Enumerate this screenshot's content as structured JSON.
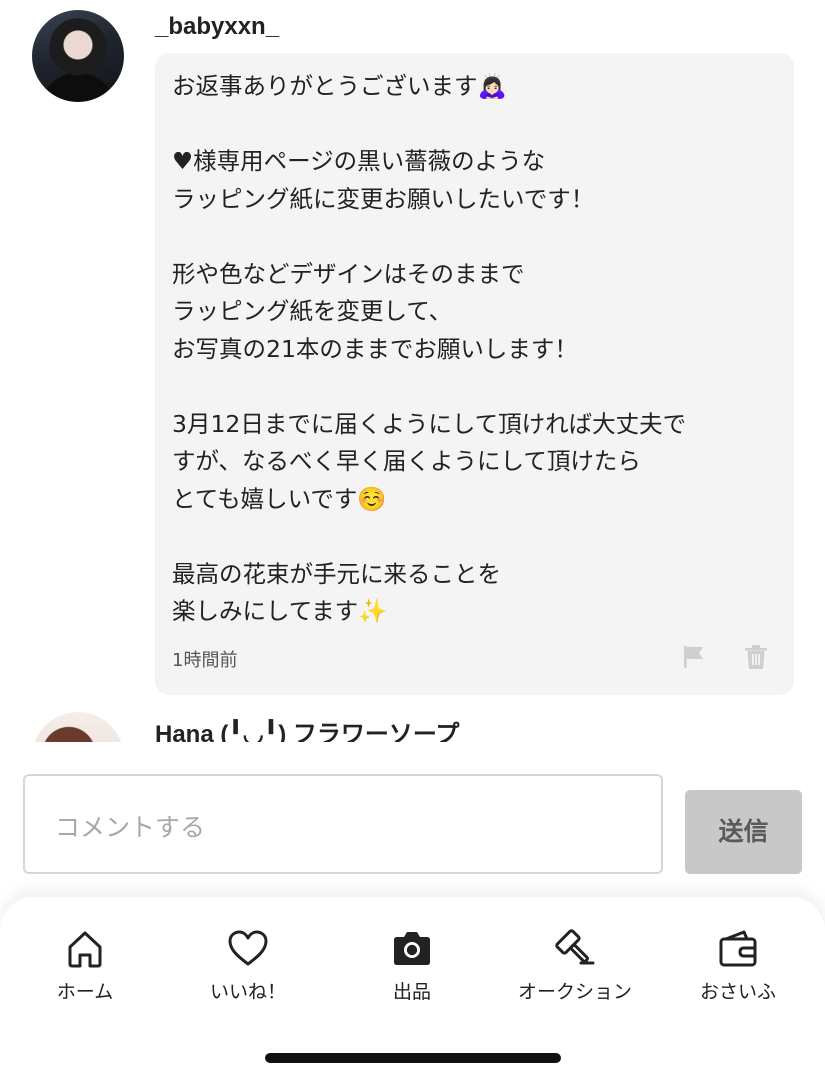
{
  "comments": [
    {
      "username": "_babyxxn_",
      "message": "お返事ありがとうございます🙇🏻‍♀️\n\n♥様専用ページの黒い薔薇のような\nラッピング紙に変更お願いしたいです！\n\n形や色などデザインはそのままで\nラッピング紙を変更して、\nお写真の21本のままでお願いします！\n\n3月12日までに届くようにして頂ければ大丈夫で\nすが、なるべく早く届くようにして頂けたら\nとても嬉しいです☺️\n\n最高の花束が手元に来ることを\n楽しみにしてます✨",
      "time": "1時間前",
      "icons": [
        "flag-icon",
        "trash-icon"
      ]
    },
    {
      "username": "Hana (╹◡╹) フラワーソープ"
    }
  ],
  "comment_input": {
    "placeholder": "コメントする",
    "send_label": "送信"
  },
  "tabbar": [
    {
      "label": "ホーム",
      "icon": "home-icon"
    },
    {
      "label": "いいね！",
      "icon": "heart-icon"
    },
    {
      "label": "出品",
      "icon": "camera-icon"
    },
    {
      "label": "オークション",
      "icon": "gavel-icon"
    },
    {
      "label": "おさいふ",
      "icon": "wallet-icon"
    }
  ],
  "colors": {
    "bubble_bg": "#f4f4f5",
    "send_button_bg": "#c8c8c8",
    "text": "#222222"
  }
}
